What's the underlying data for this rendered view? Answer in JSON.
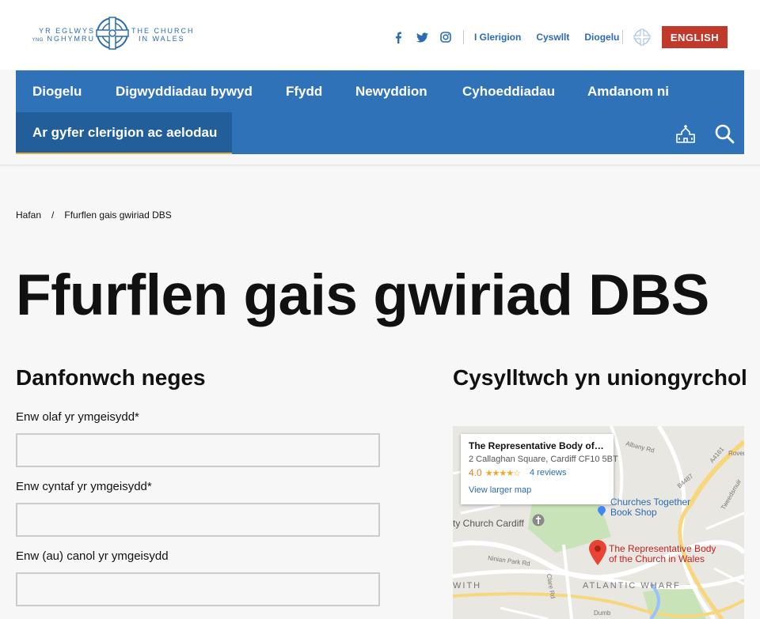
{
  "header": {
    "logo_welsh_line1": "YR EGLWYS",
    "logo_welsh_small": "YNG",
    "logo_welsh_line2": "NGHYMRU",
    "logo_english_line1": "THE CHURCH",
    "logo_english_line2": "IN WALES",
    "social_icons": [
      "facebook-icon",
      "twitter-icon",
      "instagram-icon"
    ],
    "utility_links": [
      "I Glerigion",
      "Cyswllt",
      "Diogelu"
    ],
    "language_button": "ENGLISH",
    "colors": {
      "brand_blue": "#2f72b8",
      "language_red": "#c0392b",
      "active_underline": "#e0b040"
    }
  },
  "nav": {
    "items": [
      "Diogelu",
      "Digwyddiadau bywyd",
      "Ffydd",
      "Newyddion",
      "Cyhoeddiadau",
      "Amdanom ni"
    ],
    "active_item": "Ar gyfer clerigion ac aelodau",
    "icons": [
      "church-icon",
      "search-icon"
    ]
  },
  "breadcrumb": {
    "home": "Hafan",
    "separator": "/",
    "current": "Ffurflen gais gwiriad DBS"
  },
  "page_title": "Ffurflen gais gwiriad DBS",
  "form": {
    "heading": "Danfonwch neges",
    "fields": [
      {
        "label": "Enw olaf yr ymgeisydd*",
        "value": ""
      },
      {
        "label": "Enw cyntaf yr ymgeisydd*",
        "value": ""
      },
      {
        "label": "Enw (au) canol yr ymgeisydd",
        "value": ""
      }
    ]
  },
  "contact": {
    "heading": "Cysylltwch yn uniongyrchol",
    "map": {
      "place_name": "The Representative Body of th...",
      "address": "2 Callaghan Square, Cardiff CF10 5BT",
      "rating": "4.0",
      "stars": "★★★★☆",
      "reviews": "4 reviews",
      "larger_map": "View larger map",
      "labels": {
        "shop_line1": "Churches Together",
        "shop_line2": "Book Shop",
        "church": "ty Church Cardiff",
        "pin_line1": "The Representative Body",
        "pin_line2": "of the Church in Wales",
        "district": "ATLANTIC WHARF",
        "district2": "WITH",
        "road1": "Albany Rd",
        "road2": "A4161",
        "road3": "B4487",
        "road4": "Ninian Park Rd",
        "road5": "Clare Rd",
        "road6": "Tweedsmuir",
        "road7": "Rover",
        "road8": "Dumb"
      }
    }
  }
}
